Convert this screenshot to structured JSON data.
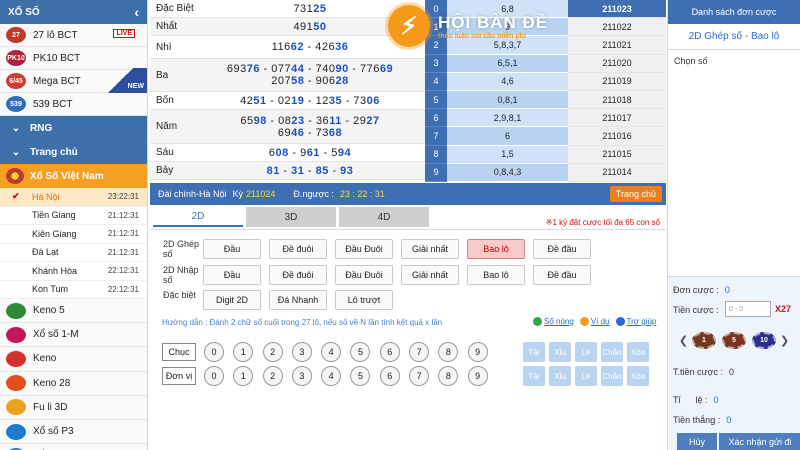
{
  "sidebar": {
    "title": "XỔ SỐ",
    "back_icon": "chevron-left-icon",
    "games": [
      {
        "label": "27 lô BCT",
        "badge_text": "27",
        "color": "#c0392b",
        "live": "LIVE"
      },
      {
        "label": "PK10 BCT",
        "badge_text": "PK10",
        "color": "#b0243a"
      },
      {
        "label": "Mega BCT",
        "badge_text": "6/45",
        "color": "#d23b2f",
        "ribbon": "NEW"
      },
      {
        "label": "539 BCT",
        "badge_text": "539",
        "color": "#2f6fc2"
      }
    ],
    "rng_label": "RNG",
    "main_label": "Trang chủ",
    "vn_label": "Xổ Số Việt Nam",
    "provinces": [
      {
        "name": "Hà Nội",
        "time": "23:22:31"
      },
      {
        "name": "Tiền Giang",
        "time": "21:12:31"
      },
      {
        "name": "Kiên Giang",
        "time": "21:12:31"
      },
      {
        "name": "Đà Lạt",
        "time": "21:12:31"
      },
      {
        "name": "Khánh Hòa",
        "time": "22:12:31"
      },
      {
        "name": "Kon Tum",
        "time": "22:12:31"
      }
    ],
    "others": [
      {
        "label": "Keno 5",
        "color": "#2c8a3a"
      },
      {
        "label": "Xổ số 1-M",
        "color": "#c2185b"
      },
      {
        "label": "Keno",
        "color": "#d32f2f"
      },
      {
        "label": "Keno 28",
        "color": "#e04f1c"
      },
      {
        "label": "Fu li 3D",
        "color": "#f0a020"
      },
      {
        "label": "Xổ số P3",
        "color": "#1f7bd0"
      },
      {
        "label": "Xổ Số Thái Lan",
        "color": "#3a7ad0"
      }
    ]
  },
  "results": [
    {
      "prize": "Đặc Biệt",
      "lines": [
        "73125"
      ]
    },
    {
      "prize": "Nhất",
      "lines": [
        "49150"
      ]
    },
    {
      "prize": "Nhì",
      "lines": [
        "11662 - 42636"
      ]
    },
    {
      "prize": "Ba",
      "lines": [
        "69376 - 07744 - 74090 - 77669",
        "20758 - 90628"
      ]
    },
    {
      "prize": "Bốn",
      "lines": [
        "4251 - 0219 - 1235 - 7306"
      ]
    },
    {
      "prize": "Năm",
      "lines": [
        "6598 - 0823 - 3611 - 2927",
        "6946 - 7368"
      ]
    },
    {
      "prize": "Sáu",
      "lines": [
        "608 - 961 - 594"
      ]
    },
    {
      "prize": "Bảy",
      "lines": [
        "81 - 31 - 85 - 93"
      ]
    }
  ],
  "loto": [
    {
      "ix": "0",
      "vals": "6,8"
    },
    {
      "ix": "1",
      "vals": "9"
    },
    {
      "ix": "2",
      "vals": "5,8,3,7"
    },
    {
      "ix": "3",
      "vals": "6,5,1"
    },
    {
      "ix": "4",
      "vals": "4,6"
    },
    {
      "ix": "5",
      "vals": "0,8,1"
    },
    {
      "ix": "6",
      "vals": "2,9,8,1"
    },
    {
      "ix": "7",
      "vals": "6"
    },
    {
      "ix": "8",
      "vals": "1,5"
    },
    {
      "ix": "9",
      "vals": "0,8,4,3"
    }
  ],
  "periods": [
    "211023",
    "211022",
    "211021",
    "211020",
    "211019",
    "211018",
    "211017",
    "211016",
    "211015",
    "211014"
  ],
  "logo": {
    "title": "HỘI BÀN ĐỀ",
    "subtitle": "thảo luận soi cầu miễn phí"
  },
  "status": {
    "label": "Đài chính-Hà Nội",
    "period_label": "Kỳ",
    "period": "211024",
    "countdown_label": "Đ.ngược :",
    "countdown": "23 : 22 : 31",
    "home_button": "Trang chủ"
  },
  "bet": {
    "tabs": [
      "2D",
      "3D",
      "4D"
    ],
    "note": "※1 kỳ đặt cược tối đa 65 con số",
    "groups": [
      {
        "label": "2D Ghép số",
        "options": [
          "Đầu",
          "Đề đuôi",
          "Đầu Đuôi",
          "Giải nhất",
          "Bao lô",
          "Đề đầu"
        ]
      },
      {
        "label": "2D Nhập số",
        "options": [
          "Đầu",
          "Đề đuôi",
          "Đầu Đuôi",
          "Giải nhất",
          "Bao lô",
          "Đề đầu"
        ]
      },
      {
        "label": "Đặc biệt",
        "options": [
          "Digit 2D",
          "Đá Nhanh",
          "Lô trượt"
        ]
      }
    ],
    "guide": "Hướng dẫn : Đánh 2 chữ số cuối trong 27 lô, nếu số về N lần tính kết quả x lần",
    "links": [
      "Số nóng",
      "Ví dụ",
      "Trợ giúp"
    ],
    "pad_labels": [
      "Chục",
      "Đơn vị"
    ],
    "digits": [
      "0",
      "1",
      "2",
      "3",
      "4",
      "5",
      "6",
      "7",
      "8",
      "9"
    ],
    "quick": [
      "Tài",
      "Xỉu",
      "Lẻ",
      "Chẵn",
      "Xóa"
    ]
  },
  "right": {
    "title": "Danh sách đơn cược",
    "subtitle": "2D Ghép số - Bao lô",
    "chon_so": "Chọn số",
    "don_cuoc_label": "Đơn cược :",
    "don_cuoc_value": "0",
    "tien_cuoc_label": "Tiền cược :",
    "tien_cuoc_placeholder": "0 - 0",
    "multiplier": "X27",
    "chips": [
      {
        "value": "1",
        "color": "#6e3b1f"
      },
      {
        "value": "5",
        "color": "#7a3520"
      },
      {
        "value": "10",
        "color": "#2d2f8f"
      }
    ],
    "t_tien_cuoc_label": "T.tiền cược :",
    "t_tien_cuoc_value": "0",
    "ti_le_label": "Tỉ      lệ :",
    "ti_le_value": "0",
    "tien_thang_label": "Tiền thắng :",
    "tien_thang_value": "0",
    "cancel_button": "Hủy",
    "confirm_button": "Xác nhận gửi đi"
  }
}
